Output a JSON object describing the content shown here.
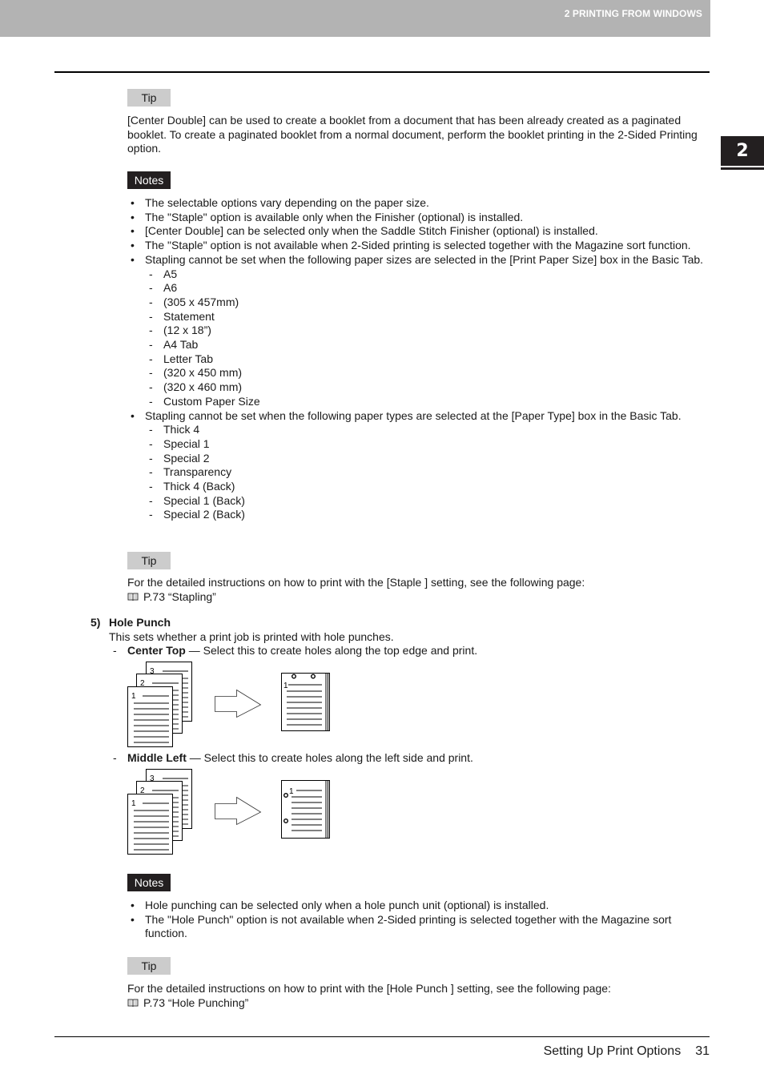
{
  "header": {
    "section_title": "2 PRINTING FROM WINDOWS"
  },
  "chapter_tab": {
    "number": "2"
  },
  "tip1": {
    "label": "Tip",
    "text": "[Center Double] can be used to create a booklet from a document that has been already created as a paginated booklet.  To create a paginated booklet from a normal document, perform the booklet printing in the 2-Sided Printing option."
  },
  "notes1": {
    "label": "Notes",
    "items": [
      "The selectable options vary depending on the paper size.",
      "The \"Staple\" option is available only when the Finisher (optional) is installed.",
      "[Center Double] can be selected only when the Saddle Stitch Finisher (optional) is installed.",
      "The \"Staple\" option is not available when 2-Sided printing is selected together with the Magazine sort function.",
      "Stapling cannot be set when the following paper sizes are selected in the [Print Paper Size] box in the Basic Tab."
    ],
    "paper_sizes": [
      "A5",
      "A6",
      "(305 x 457mm)",
      "Statement",
      "(12 x 18”)",
      "A4 Tab",
      "Letter Tab",
      "(320 x 450 mm)",
      "(320 x 460 mm)",
      "Custom Paper Size"
    ],
    "paper_type_note": "Stapling cannot be set when the following paper types are selected at the [Paper Type] box in the Basic Tab.",
    "paper_types": [
      "Thick 4",
      "Special 1",
      "Special 2",
      "Transparency",
      "Thick 4 (Back)",
      "Special 1 (Back)",
      "Special 2 (Back)"
    ]
  },
  "tip2": {
    "label": "Tip",
    "text": "For the detailed instructions on how to print with the [Staple ] setting, see the following page:",
    "ref": "P.73 “Stapling”"
  },
  "step5": {
    "number": "5)",
    "title": "Hole Punch",
    "description": "This sets whether a print job is printed with hole punches.",
    "options": [
      {
        "dash": "-",
        "name": "Center Top",
        "text": " — Select this to create holes along the top edge and print."
      },
      {
        "dash": "-",
        "name": "Middle Left",
        "text": " — Select this to create holes along the left side and print."
      }
    ],
    "illustration_labels": {
      "page1": "1",
      "page2": "2",
      "page3": "3"
    }
  },
  "notes2": {
    "label": "Notes",
    "items": [
      "Hole punching can be selected only when a hole punch unit (optional) is installed.",
      "The \"Hole Punch\" option is not available when 2-Sided printing is selected together with the Magazine sort function."
    ]
  },
  "tip3": {
    "label": "Tip",
    "text": "For the detailed instructions on how to print with the [Hole Punch ] setting, see the following page:",
    "ref": "P.73 “Hole Punching”"
  },
  "footer": {
    "section": "Setting Up Print Options",
    "page_number": "31"
  }
}
